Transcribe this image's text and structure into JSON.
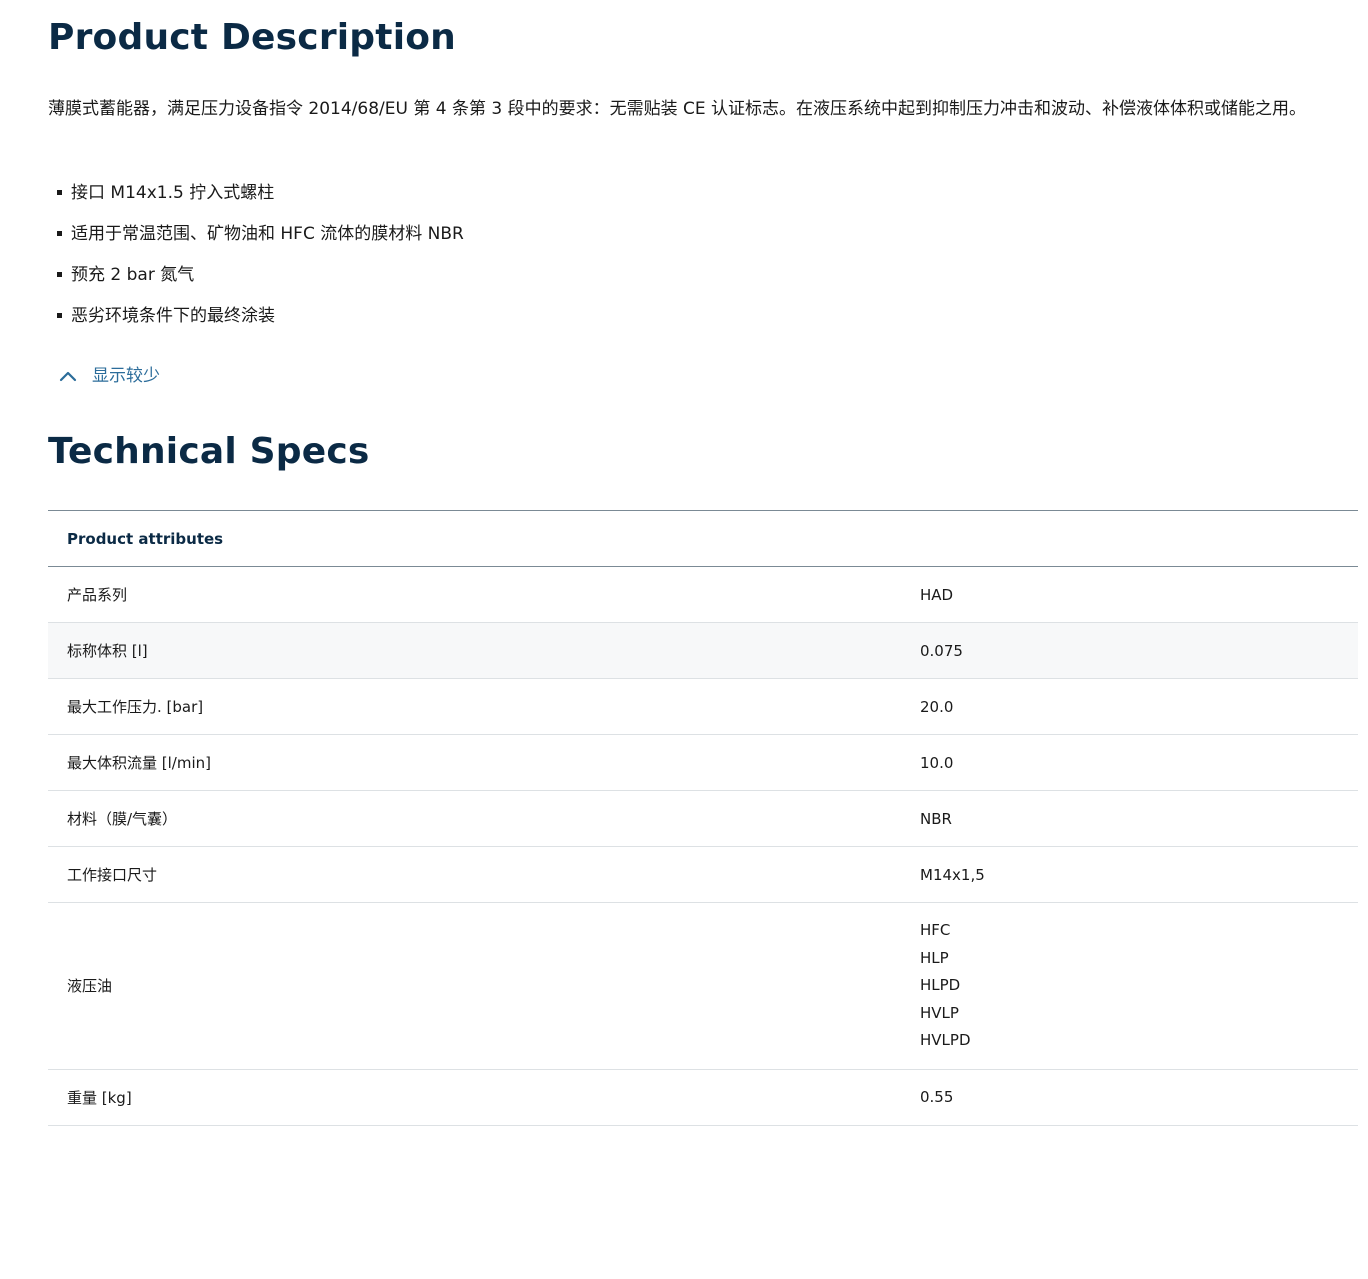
{
  "description": {
    "title": "Product Description",
    "text": "薄膜式蓄能器，满足压力设备指令 2014/68/EU 第 4 条第 3 段中的要求：无需贴装 CE 认证标志。在液压系统中起到抑制压力冲击和波动、补偿液体体积或储能之用。",
    "bullets": [
      "接口 M14x1.5 拧入式螺柱",
      "适用于常温范围、矿物油和 HFC 流体的膜材料 NBR",
      "预充 2 bar 氮气",
      "恶劣环境条件下的最终涂装"
    ],
    "toggle_label": "显示较少",
    "toggle_icon": "chevron-up-icon"
  },
  "specs": {
    "title": "Technical Specs",
    "header": "Product attributes",
    "rows": [
      {
        "label": "产品系列",
        "value": "HAD"
      },
      {
        "label": "标称体积 [l]",
        "value": "0.075"
      },
      {
        "label": "最大工作压力. [bar]",
        "value": "20.0"
      },
      {
        "label": "最大体积流量 [l/min]",
        "value": "10.0"
      },
      {
        "label": "材料（膜/气囊）",
        "value": "NBR"
      },
      {
        "label": "工作接口尺寸",
        "value": "M14x1,5"
      },
      {
        "label": "液压油",
        "values": [
          "HFC",
          "HLP",
          "HLPD",
          "HVLP",
          "HVLPD"
        ]
      },
      {
        "label": "重量 [kg]",
        "value": "0.55"
      }
    ]
  },
  "colors": {
    "heading": "#0b2a45",
    "link": "#2b6c9a",
    "row_alt": "#f7f8f9",
    "border": "#dde1e4"
  }
}
